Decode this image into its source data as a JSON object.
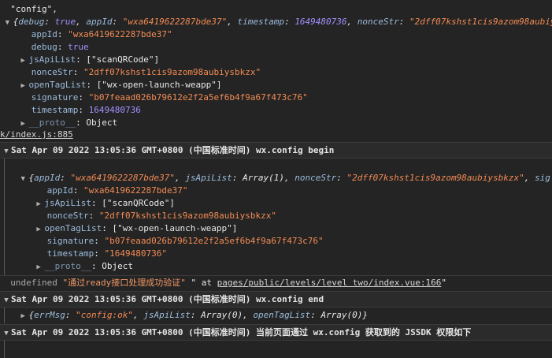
{
  "block1": {
    "config_label": "\"config\",",
    "summary_brace": "{",
    "summary_debug_key": "debug",
    "summary_debug_val": "true",
    "summary_appid_key": "appId",
    "summary_appid_val": "\"wxa6419622287bde37\"",
    "summary_ts_key": "timestamp",
    "summary_ts_val": "1649480736",
    "summary_nonce_key": "nonceStr",
    "summary_nonce_val": "\"2dff07kshst1cis9azom98aubiysbkzx\"",
    "appId_key": "appId",
    "appId_val": "\"wxa6419622287bde37\"",
    "debug_key": "debug",
    "debug_val": "true",
    "jsApiList_key": "jsApiList",
    "jsApiList_val": "[\"scanQRCode\"]",
    "nonceStr_key": "nonceStr",
    "nonceStr_val": "\"2dff07kshst1cis9azom98aubiysbkzx\"",
    "openTagList_key": "openTagList",
    "openTagList_val": "[\"wx-open-launch-weapp\"]",
    "signature_key": "signature",
    "signature_val": "\"b07feaad026b79612e2f2a5ef6b4f9a67f473c76\"",
    "timestamp_key": "timestamp",
    "timestamp_val": "1649480736",
    "proto_key": "__proto__",
    "proto_val": "Object",
    "source_link": "k/index.js:885"
  },
  "group1": {
    "title": "Sat Apr 09 2022 13:05:36 GMT+0800 (中国标准时间) wx.config begin"
  },
  "block2": {
    "summary_appid_key": "appId",
    "summary_appid_val": "\"wxa6419622287bde37\"",
    "summary_jsapi_key": "jsApiList",
    "summary_jsapi_val": "Array(1)",
    "summary_nonce_key": "nonceStr",
    "summary_nonce_val": "\"2dff07kshst1cis9azom98aubiysbkzx\"",
    "summary_sig_key": "sig",
    "appId_key": "appId",
    "appId_val": "\"wxa6419622287bde37\"",
    "jsApiList_key": "jsApiList",
    "jsApiList_val": "[\"scanQRCode\"]",
    "nonceStr_key": "nonceStr",
    "nonceStr_val": "\"2dff07kshst1cis9azom98aubiysbkzx\"",
    "openTagList_key": "openTagList",
    "openTagList_val": "[\"wx-open-launch-weapp\"]",
    "signature_key": "signature",
    "signature_val": "\"b07feaad026b79612e2f2a5ef6b4f9a67f473c76\"",
    "timestamp_key": "timestamp",
    "timestamp_val": "\"1649480736\"",
    "proto_key": "__proto__",
    "proto_val": "Object"
  },
  "log_line": {
    "prefix": "undefined ",
    "msg": "\"通过ready接口处理成功验证\"",
    "mid": " \" at ",
    "path_a": "pages",
    "path_b": "/public/levels/level two/index.vue:166",
    "suffix": "\""
  },
  "group2": {
    "title": "Sat Apr 09 2022 13:05:36 GMT+0800 (中国标准时间) wx.config end"
  },
  "block3": {
    "errmsg_key": "errMsg",
    "errmsg_val": "\"config:ok\"",
    "jsapi_key": "jsApiList",
    "jsapi_val": "Array(0)",
    "opentag_key": "openTagList",
    "opentag_val": "Array(0)"
  },
  "group3": {
    "title": "Sat Apr 09 2022 13:05:36 GMT+0800 (中国标准时间) 当前页面通过 wx.config 获取到的 JSSDK 权限如下"
  },
  "icons": {
    "expanded": "▼",
    "collapsed": "▶"
  }
}
